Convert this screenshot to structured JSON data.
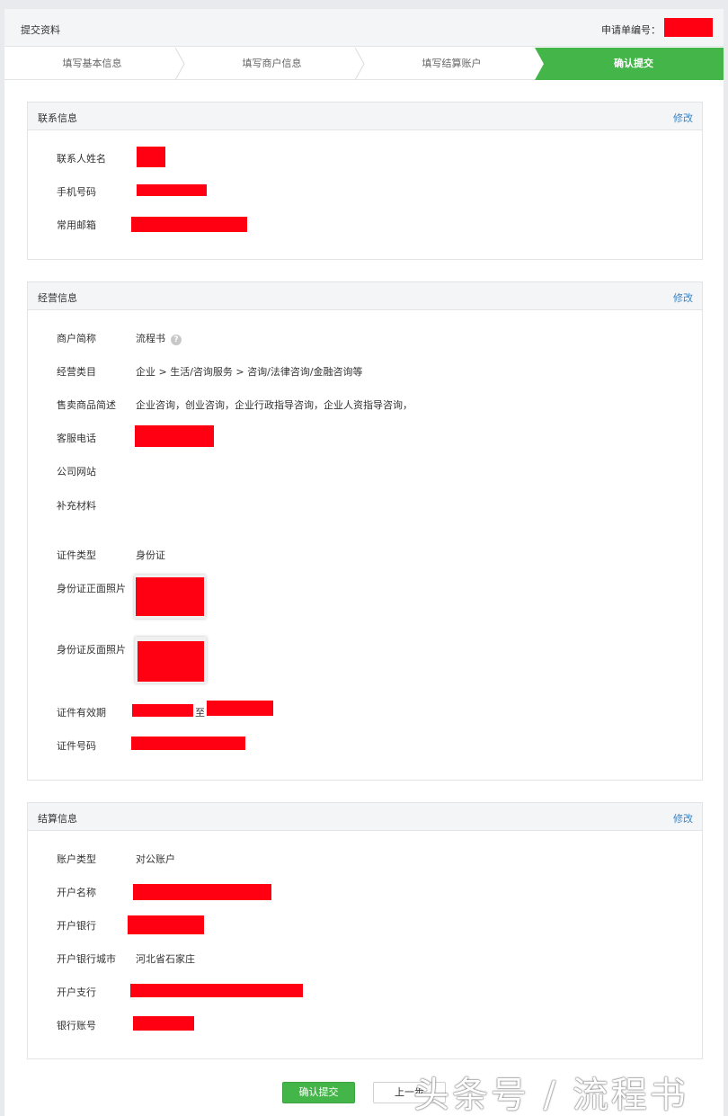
{
  "header": {
    "title": "提交资料",
    "application_no_label": "申请单编号："
  },
  "steps": [
    {
      "label": "填写基本信息",
      "active": false
    },
    {
      "label": "填写商户信息",
      "active": false
    },
    {
      "label": "填写结算账户",
      "active": false
    },
    {
      "label": "确认提交",
      "active": true
    }
  ],
  "contact": {
    "title": "联系信息",
    "edit": "修改",
    "fields": [
      {
        "label": "联系人姓名"
      },
      {
        "label": "手机号码"
      },
      {
        "label": "常用邮箱"
      }
    ]
  },
  "business": {
    "title": "经营信息",
    "edit": "修改",
    "short_name_label": "商户简称",
    "short_name_value": "流程书",
    "help_icon": "?",
    "category_label": "经营类目",
    "category_value": "企业 > 生活/咨询服务 > 咨询/法律咨询/金融咨询等",
    "goods_label": "售卖商品简述",
    "goods_value": "企业咨询，创业咨询，企业行政指导咨询，企业人资指导咨询，",
    "phone_label": "客服电话",
    "website_label": "公司网站",
    "materials_label": "补充材料",
    "id_type_label": "证件类型",
    "id_type_value": "身份证",
    "id_front_label": "身份证正面照片",
    "id_back_label": "身份证反面照片",
    "validity_label": "证件有效期",
    "validity_to": "至",
    "id_number_label": "证件号码"
  },
  "settlement": {
    "title": "结算信息",
    "edit": "修改",
    "account_type_label": "账户类型",
    "account_type_value": "对公账户",
    "account_name_label": "开户名称",
    "bank_label": "开户银行",
    "bank_city_label": "开户银行城市",
    "bank_city_value": "河北省石家庄",
    "branch_label": "开户支行",
    "account_no_label": "银行账号"
  },
  "buttons": {
    "submit": "确认提交",
    "prev": "上一步"
  },
  "watermark": "头条号 / 流程书",
  "colors": {
    "accent_green": "#44b549",
    "link_blue": "#3b84c4",
    "redaction": "#ff0012"
  }
}
